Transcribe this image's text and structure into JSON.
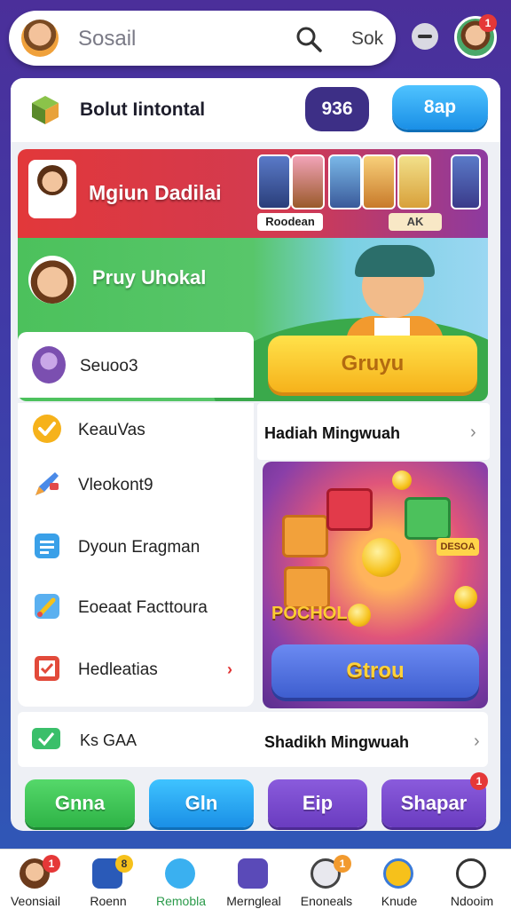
{
  "search": {
    "placeholder": "Sosail",
    "button_label": "Sok"
  },
  "header_badge": "1",
  "row1": {
    "title": "Bolut Iintontal",
    "pill1": "936",
    "pill2": "8ap"
  },
  "red_banner": {
    "title": "Mgiun Dadilai",
    "thumb_label1": "Roodean",
    "thumb_label2": "AK"
  },
  "green_banner": {
    "title": "Pruy Uhokal"
  },
  "side_card": {
    "label": "Seuoo3"
  },
  "yellow_button": "Gruyu",
  "list": [
    {
      "label": "KeauVas",
      "icon": "check-icon"
    },
    {
      "label": "Vleokont9",
      "icon": "pencil-icon"
    },
    {
      "label": "Dyoun Eragman",
      "icon": "document-icon"
    },
    {
      "label": "Eoeaat Facttoura",
      "icon": "brush-icon"
    },
    {
      "label": "Hedleatias",
      "icon": "checklist-icon",
      "chevron": "›"
    }
  ],
  "hadiah": {
    "label": "Hadiah Mingwuah",
    "chevron": "›"
  },
  "reward_card": {
    "promo_text": "POCHOL",
    "tag": "DESOA",
    "button": "Gtrou"
  },
  "bottom_row": {
    "left_label": "Ks GAA",
    "right_label": "Shadikh Mingwuah",
    "chevron": "›"
  },
  "actions": [
    {
      "label": "Gnna"
    },
    {
      "label": "Gln"
    },
    {
      "label": "Eip"
    },
    {
      "label": "Shapar",
      "badge": "1"
    }
  ],
  "nav": [
    {
      "label": "Veonsiail",
      "badge": "1"
    },
    {
      "label": "Roenn",
      "badge": "8"
    },
    {
      "label": "Remobla"
    },
    {
      "label": "Merngleal"
    },
    {
      "label": "Enoneals",
      "badge": "1"
    },
    {
      "label": "Knude"
    },
    {
      "label": "Ndooim"
    }
  ]
}
